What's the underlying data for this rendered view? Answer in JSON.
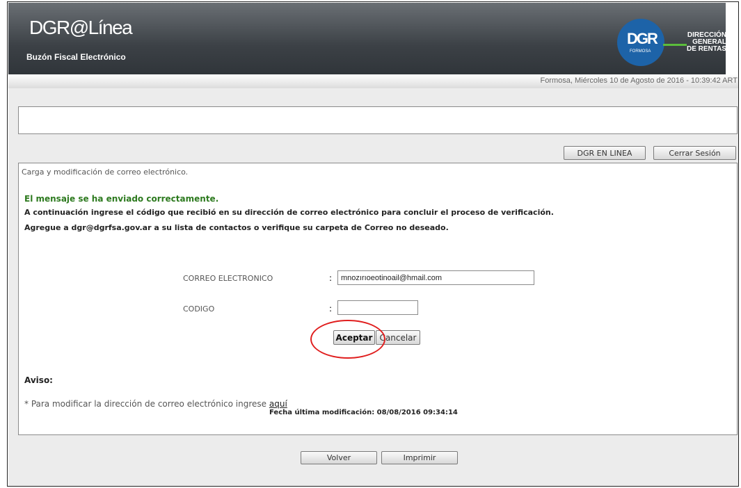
{
  "header": {
    "title": "DGR@Línea",
    "subtitle": "Buzón Fiscal Electrónico",
    "logo": {
      "mark": "DGR",
      "region": "FORMOSA",
      "text": [
        "DIRECCIÓN",
        "GENERAL",
        "DE RENTAS"
      ]
    }
  },
  "date": "Formosa, Miércoles 10 de Agosto de 2016 - 10:39:42 ART",
  "toolbar": {
    "dgr_en_linea": "DGR EN LINEA",
    "cerrar_sesion": "Cerrar Sesión"
  },
  "main": {
    "section_title": "Carga y modificación de correo electrónico.",
    "success": "El mensaje se ha enviado correctamente.",
    "instructions": [
      "A continuación ingrese el código que recibió en su dirección de correo electrónico para concluir el proceso de verificación.",
      "Agregue a dgr@dgrfsa.gov.ar a su lista de contactos o verifique su carpeta de Correo no deseado."
    ],
    "form": {
      "email_label": "CORREO ELECTRONICO",
      "email_value": "mnozırıoeotinoail@hmail.com",
      "code_label": "CODIGO",
      "code_value": "",
      "separator": ":",
      "accept": "Aceptar",
      "cancel": "Cancelar"
    },
    "notice": {
      "heading": "Aviso:",
      "text": "* Para modificar la dirección de correo electrónico ingrese",
      "link": "aquí"
    }
  },
  "bottom": {
    "volver": "Volver",
    "imprimir": "Imprimir"
  },
  "footer": "Fecha última modificación: 08/08/2016 09:34:14",
  "colors": {
    "success_green": "#2d7a1f",
    "header_dark": "#3c4146",
    "annotation_red": "#e01e1e"
  }
}
